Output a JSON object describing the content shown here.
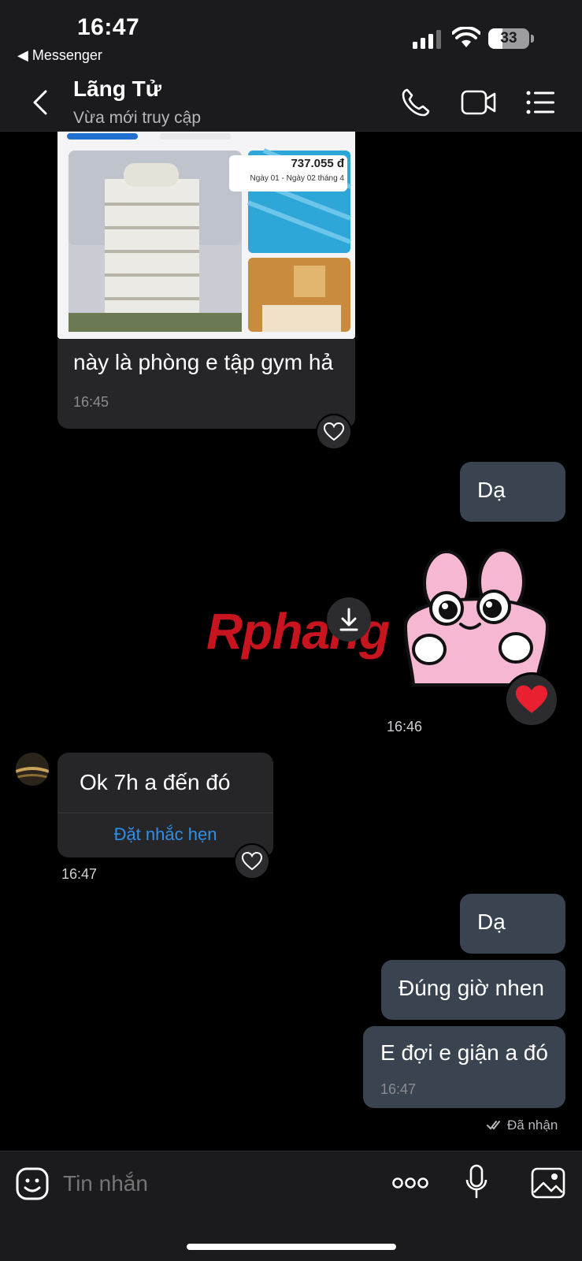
{
  "status_bar": {
    "time": "16:47",
    "back_app": "◀ Messenger",
    "battery": "33"
  },
  "header": {
    "contact_name": "Lãng Tử",
    "contact_status": "Vừa mới truy cập"
  },
  "messages": {
    "card": {
      "price": "737.055 đ",
      "dates": "Ngày 01 - Ngày 02 tháng 4",
      "text": "này là phòng e tập gym hả",
      "time": "16:45"
    },
    "out1": {
      "text": "Dạ"
    },
    "sticker": {
      "time": "16:46",
      "reaction": "❤"
    },
    "watermark": "Rphang",
    "in1": {
      "text": "Ok 7h a đến đó",
      "action": "Đặt nhắc hẹn",
      "time": "16:47"
    },
    "out2": {
      "text": "Dạ"
    },
    "out3": {
      "text": "Đúng giờ nhen"
    },
    "out4": {
      "text": "E đợi e giận a đó",
      "time": "16:47"
    },
    "delivery_status": "Đã nhận"
  },
  "composer": {
    "placeholder": "Tin nhắn"
  },
  "colors": {
    "accent": "#2f8fe8",
    "out_bubble": "#3a4350",
    "in_bubble": "#262628",
    "background": "#000000"
  }
}
